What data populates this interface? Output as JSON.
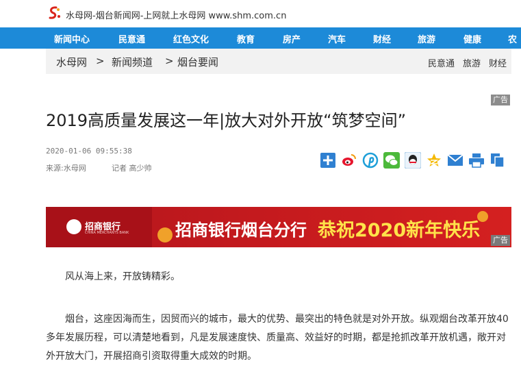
{
  "header": {
    "site_title": "水母网-烟台新闻网-上网就上水母网 www.shm.com.cn"
  },
  "nav": {
    "items": [
      "新闻中心",
      "民意通",
      "红色文化",
      "教育",
      "房产",
      "汽车",
      "财经",
      "旅游",
      "健康",
      "农"
    ]
  },
  "breadcrumb": {
    "items": [
      "水母网",
      "新闻频道",
      "烟台要闻"
    ],
    "separator": ">"
  },
  "quick_links": [
    "民意通",
    "旅游",
    "财经"
  ],
  "ad_label": "广告",
  "article": {
    "title": "2019高质量发展这一年|放大对外开放“筑梦空间”",
    "datetime": "2020-01-06 09:55:38",
    "source": "来源:水母网",
    "author": "记者 高少帅",
    "paragraphs": [
      "风从海上来，开放铸精彩。",
      "烟台，这座因海而生，因贸而兴的城市，最大的优势、最突出的特色就是对外开放。纵观烟台改革开放40多年发展历程，可以清楚地看到，凡是发展速度快、质量高、效益好的时期，都是抢抓改革开放机遇，敞开对外开放大门，开展招商引资取得重大成效的时期。"
    ]
  },
  "share_icons": [
    "plus-share-icon",
    "weibo-icon",
    "pinterest-icon",
    "wechat-icon",
    "qq-icon",
    "qzone-icon",
    "email-icon",
    "print-icon",
    "copy-icon"
  ],
  "banner": {
    "bank_name": "招商银行",
    "bank_en": "CHINA MERCHANTS BANK",
    "main_text": "招商银行烟台分行",
    "greeting": "恭祝2020新年快乐"
  },
  "colors": {
    "nav_bg": "#1d8ad8",
    "crumb_bg": "#f2f2f2",
    "banner_red": "#c41a1e",
    "greeting_yellow": "#ffe34a"
  }
}
